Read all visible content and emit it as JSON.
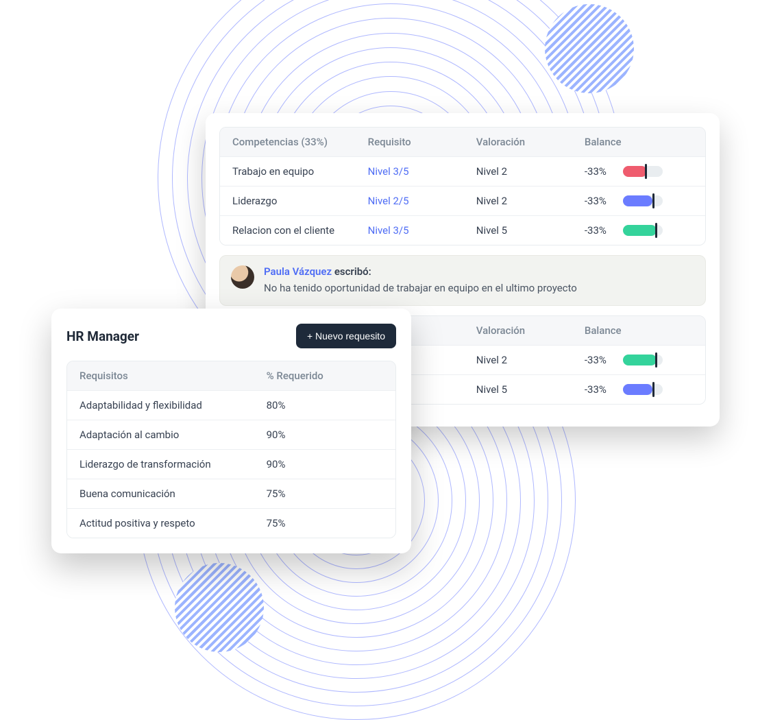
{
  "competencies": {
    "headers": {
      "competencias": "Competencias (33%)",
      "requisito": "Requisito",
      "valoracion": "Valoración",
      "balance": "Balance"
    },
    "rows": [
      {
        "name": "Trabajo en equipo",
        "requisito": "Nivel 3/5",
        "valoracion": "Nivel 2",
        "balance": "-33%",
        "color": "red",
        "marker": "m55"
      },
      {
        "name": "Liderazgo",
        "requisito": "Nivel 2/5",
        "valoracion": "Nivel 2",
        "balance": "-33%",
        "color": "blue",
        "marker": "m75"
      },
      {
        "name": "Relacion con el cliente",
        "requisito": "Nivel 3/5",
        "valoracion": "Nivel 5",
        "balance": "-33%",
        "color": "green",
        "marker": "m82"
      }
    ]
  },
  "comment": {
    "author": "Paula Vázquez",
    "wrote_label": "escribó:",
    "text": "No ha tenido oportunidad de trabajar en equipo en el ultimo proyecto"
  },
  "competencies2": {
    "headers": {
      "valoracion": "Valoración",
      "balance": "Balance"
    },
    "rows": [
      {
        "valoracion": "Nivel 2",
        "balance": "-33%",
        "color": "green",
        "marker": "m82"
      },
      {
        "valoracion": "Nivel 5",
        "balance": "-33%",
        "color": "blue",
        "marker": "m75"
      }
    ]
  },
  "hr": {
    "title": "HR Manager",
    "new_button": "+ Nuevo requesito",
    "headers": {
      "requisitos": "Requisitos",
      "requerido": "% Requerido"
    },
    "rows": [
      {
        "name": "Adaptabilidad y flexibilidad",
        "pct": "80%"
      },
      {
        "name": "Adaptación al cambio",
        "pct": "90%"
      },
      {
        "name": "Liderazgo de transformación",
        "pct": "90%"
      },
      {
        "name": "Buena comunicación",
        "pct": "75%"
      },
      {
        "name": "Actitud positiva y respeto",
        "pct": "75%"
      }
    ]
  }
}
